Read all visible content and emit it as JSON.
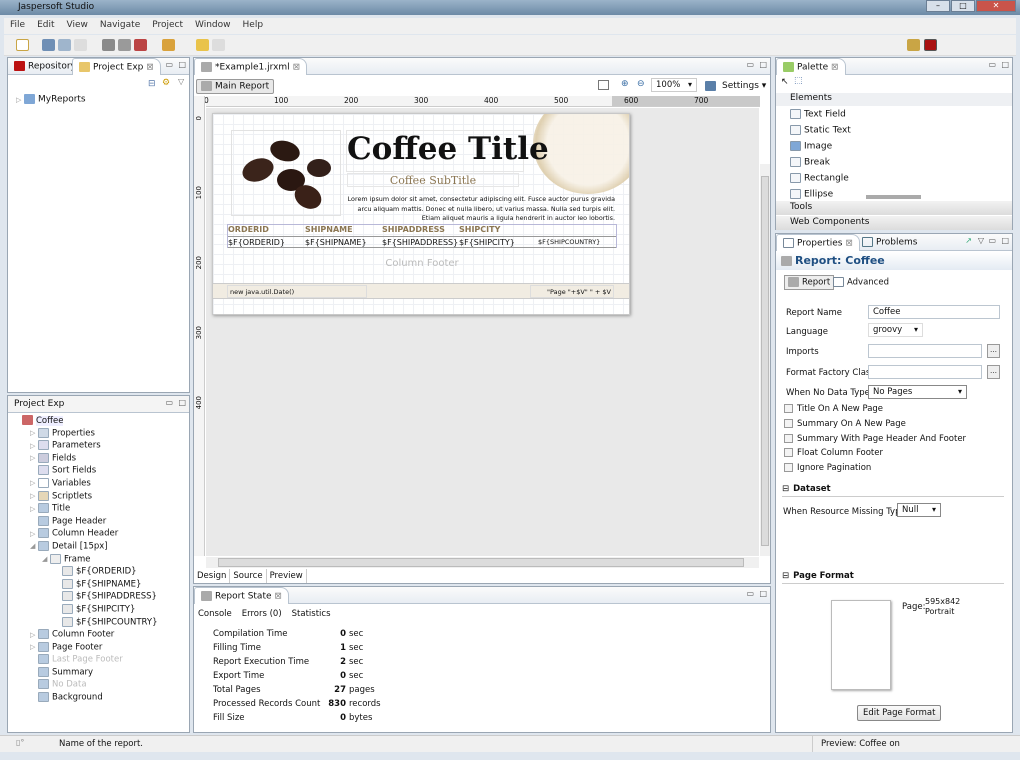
{
  "app": {
    "title": "Jaspersoft Studio"
  },
  "menu": [
    "File",
    "Edit",
    "View",
    "Navigate",
    "Project",
    "Window",
    "Help"
  ],
  "left_top": {
    "tabs": [
      "Repository",
      "Project Exp"
    ],
    "tree": [
      "MyReports"
    ]
  },
  "outline": {
    "title": "Project Exp",
    "root": "Coffee",
    "items": [
      {
        "label": "Properties",
        "level": 1,
        "expander": true,
        "disabled": false,
        "icon": "properties-icon"
      },
      {
        "label": "Parameters",
        "level": 1,
        "expander": true,
        "disabled": false,
        "icon": "parameters-icon"
      },
      {
        "label": "Fields",
        "level": 1,
        "expander": true,
        "disabled": false,
        "icon": "fields-icon"
      },
      {
        "label": "Sort Fields",
        "level": 1,
        "expander": false,
        "disabled": false,
        "icon": "sort-fields-icon"
      },
      {
        "label": "Variables",
        "level": 1,
        "expander": true,
        "disabled": false,
        "icon": "fx-icon"
      },
      {
        "label": "Scriptlets",
        "level": 1,
        "expander": true,
        "disabled": false,
        "icon": "scriptlet-icon"
      },
      {
        "label": "Title",
        "level": 1,
        "expander": true,
        "disabled": false,
        "icon": "band-icon"
      },
      {
        "label": "Page Header",
        "level": 1,
        "expander": false,
        "disabled": false,
        "icon": "band-icon"
      },
      {
        "label": "Column Header",
        "level": 1,
        "expander": true,
        "disabled": false,
        "icon": "band-icon"
      },
      {
        "label": "Detail [15px]",
        "level": 1,
        "expander": "open",
        "disabled": false,
        "icon": "band-icon"
      },
      {
        "label": "Frame",
        "level": 2,
        "expander": "open",
        "disabled": false,
        "icon": "frame-icon"
      },
      {
        "label": "$F{ORDERID}",
        "level": 3,
        "expander": false,
        "disabled": false,
        "icon": "text-field-icon"
      },
      {
        "label": "$F{SHIPNAME}",
        "level": 3,
        "expander": false,
        "disabled": false,
        "icon": "text-field-icon"
      },
      {
        "label": "$F{SHIPADDRESS}",
        "level": 3,
        "expander": false,
        "disabled": false,
        "icon": "text-field-icon"
      },
      {
        "label": "$F{SHIPCITY}",
        "level": 3,
        "expander": false,
        "disabled": false,
        "icon": "text-field-icon"
      },
      {
        "label": "$F{SHIPCOUNTRY}",
        "level": 3,
        "expander": false,
        "disabled": false,
        "icon": "text-field-icon"
      },
      {
        "label": "Column Footer",
        "level": 1,
        "expander": true,
        "disabled": false,
        "icon": "band-icon"
      },
      {
        "label": "Page Footer",
        "level": 1,
        "expander": true,
        "disabled": false,
        "icon": "band-icon"
      },
      {
        "label": "Last Page Footer",
        "level": 1,
        "expander": false,
        "disabled": true,
        "icon": "band-icon"
      },
      {
        "label": "Summary",
        "level": 1,
        "expander": false,
        "disabled": false,
        "icon": "band-icon"
      },
      {
        "label": "No Data",
        "level": 1,
        "expander": false,
        "disabled": true,
        "icon": "band-icon"
      },
      {
        "label": "Background",
        "level": 1,
        "expander": false,
        "disabled": false,
        "icon": "band-icon"
      }
    ]
  },
  "editor": {
    "tab": "*Example1.jrxml",
    "main_report": "Main Report",
    "zoom": "100%",
    "settings": "Settings",
    "ruler_h": [
      "0",
      "100",
      "200",
      "300",
      "400",
      "500",
      "600",
      "700"
    ],
    "ruler_v": [
      "0",
      "100",
      "200",
      "300",
      "400"
    ],
    "bottom_tabs": [
      "Design",
      "Source",
      "Preview"
    ]
  },
  "report": {
    "title": "Coffee Title",
    "subtitle": "Coffee SubTitle",
    "lorem": "Lorem ipsum dolor sit amet, consectetur adipiscing elit. Fusce auctor purus gravida arcu aliquam mattis. Donec et nulla libero, ut varius massa. Nulla sed turpis elit. Etiam aliquet mauris a ligula hendrerit in auctor leo lobortis.",
    "headers": [
      "ORDERID",
      "SHIPNAME",
      "SHIPADDRESS",
      "SHIPCITY"
    ],
    "fields": [
      "$F{ORDERID}",
      "$F{SHIPNAME}",
      "$F{SHIPADDRESS}",
      "$F{SHIPCITY}",
      "$F{SHIPCOUNTRY}"
    ],
    "column_footer": "Column Footer",
    "date_expr": "new java.util.Date()",
    "page_expr": "\"Page \"+$V\" \" + $V"
  },
  "report_state": {
    "title": "Report State",
    "tabs": [
      "Console",
      "Errors (0)",
      "Statistics"
    ],
    "stats": [
      {
        "label": "Compilation Time",
        "value": "0",
        "unit": "sec"
      },
      {
        "label": "Filling Time",
        "value": "1",
        "unit": "sec"
      },
      {
        "label": "Report Execution Time",
        "value": "2",
        "unit": "sec"
      },
      {
        "label": "Export Time",
        "value": "0",
        "unit": "sec"
      },
      {
        "label": "Total Pages",
        "value": "27",
        "unit": "pages"
      },
      {
        "label": "Processed Records Count",
        "value": "830",
        "unit": "records"
      },
      {
        "label": "Fill Size",
        "value": "0",
        "unit": "bytes"
      }
    ]
  },
  "palette": {
    "title": "Palette",
    "elements_label": "Elements",
    "items": [
      "Text Field",
      "Static Text",
      "Image",
      "Break",
      "Rectangle",
      "Ellipse"
    ],
    "tools": "Tools",
    "web": "Web Components"
  },
  "properties": {
    "tabs": [
      "Properties",
      "Problems"
    ],
    "heading": "Report: Coffee",
    "subtabs": [
      "Report",
      "Advanced"
    ],
    "report_name_label": "Report Name",
    "report_name": "Coffee",
    "language_label": "Language",
    "language": "groovy",
    "imports_label": "Imports",
    "imports": "",
    "ffc_label": "Format Factory Class",
    "ffc": "",
    "nodata_label": "When No Data Type",
    "nodata": "No Pages",
    "checkboxes": [
      "Title On A New Page",
      "Summary On A New Page",
      "Summary With Page Header And Footer",
      "Float Column Footer",
      "Ignore Pagination"
    ],
    "dataset_label": "Dataset",
    "resource_missing_label": "When Resource Missing Type",
    "resource_missing": "Null",
    "page_format_label": "Page Format",
    "page_label": "Page:",
    "page_size": "595x842",
    "orientation": "Portrait",
    "edit_page_format": "Edit Page Format"
  },
  "status": {
    "message": "Name of the report.",
    "right": "Preview: Coffee on"
  },
  "colors": {
    "accent": "#1f4f82",
    "header_text": "#8b7652",
    "title_bar": "#6c8aa6"
  }
}
